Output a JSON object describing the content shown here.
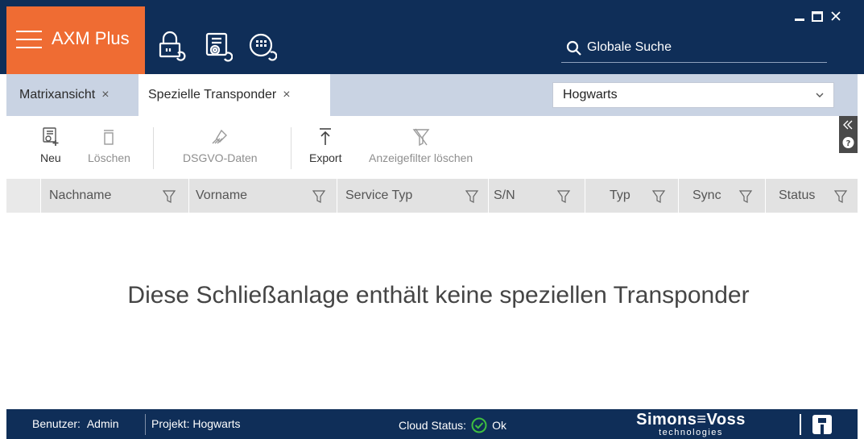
{
  "app": {
    "title": "AXM Plus"
  },
  "search": {
    "label": "Globale Suche"
  },
  "tabs": [
    {
      "label": "Matrixansicht",
      "close": "×"
    },
    {
      "label": "Spezielle Transponder",
      "close": "×"
    }
  ],
  "project_select": {
    "value": "Hogwarts"
  },
  "toolbar": {
    "new_label": "Neu",
    "delete_label": "Löschen",
    "gdpr_label": "DSGVO-Daten",
    "export_label": "Export",
    "clear_filter_label": "Anzeigefilter löschen"
  },
  "columns": [
    "Nachname",
    "Vorname",
    "Service Typ",
    "S/N",
    "Typ",
    "Sync",
    "Status"
  ],
  "empty_message": "Diese Schließanlage enthält keine speziellen Transponder",
  "statusbar": {
    "user_label": "Benutzer:",
    "user_value": "Admin",
    "project_label": "Projekt:",
    "project_value": "Hogwarts",
    "cloud_label": "Cloud Status:",
    "cloud_value": "Ok"
  },
  "logo": {
    "name": "Simons≡Voss",
    "sub": "technologies"
  },
  "colors": {
    "header": "#0f2e58",
    "brand": "#ef6c33",
    "tabbar": "#c9d3e3",
    "ok_green": "#3fbf3f"
  },
  "icons": [
    "hamburger-icon",
    "lock-sync-icon",
    "transponder-sync-icon",
    "keypad-sync-icon",
    "search-icon",
    "minimize-icon",
    "maximize-icon",
    "close-icon",
    "chevron-down-icon",
    "new-transponder-icon",
    "trash-icon",
    "gdpr-icon",
    "export-icon",
    "filter-clear-icon",
    "collapse-panel-icon",
    "help-icon",
    "filter-icon",
    "check-circle-icon"
  ]
}
